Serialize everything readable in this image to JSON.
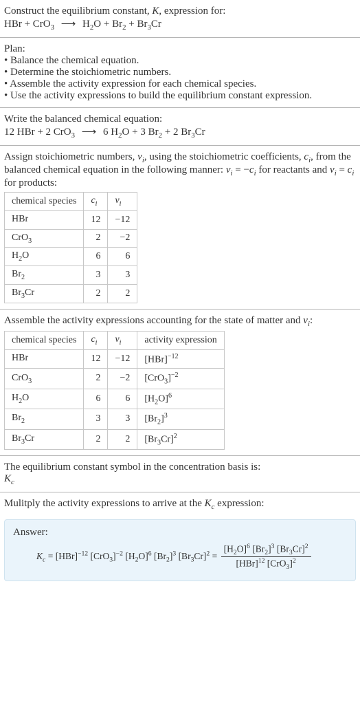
{
  "intro": {
    "line1_a": "Construct the equilibrium constant, ",
    "line1_K": "K",
    "line1_b": ", expression for:",
    "eq_lhs_1": "HBr + CrO",
    "eq_lhs_1_sub": "3",
    "arrow": "⟶",
    "eq_rhs_a": "H",
    "eq_rhs_a_sub": "2",
    "eq_rhs_b": "O + Br",
    "eq_rhs_b_sub": "2",
    "eq_rhs_c": " + Br",
    "eq_rhs_c_sub": "3",
    "eq_rhs_d": "Cr"
  },
  "plan": {
    "title": "Plan:",
    "b1": "• Balance the chemical equation.",
    "b2": "• Determine the stoichiometric numbers.",
    "b3": "• Assemble the activity expression for each chemical species.",
    "b4": "• Use the activity expressions to build the equilibrium constant expression."
  },
  "balance": {
    "title": "Write the balanced chemical equation:",
    "lhs_a": "12 HBr + 2 CrO",
    "lhs_a_sub": "3",
    "arrow": "⟶",
    "rhs_a": "6 H",
    "rhs_a_sub": "2",
    "rhs_b": "O + 3 Br",
    "rhs_b_sub": "2",
    "rhs_c": " + 2 Br",
    "rhs_c_sub": "3",
    "rhs_d": "Cr"
  },
  "assign": {
    "text_a": "Assign stoichiometric numbers, ",
    "nu_i": "ν",
    "nu_i_sub": "i",
    "text_b": ", using the stoichiometric coefficients, ",
    "c_i": "c",
    "c_i_sub": "i",
    "text_c": ", from the balanced chemical equation in the following manner: ",
    "rel_a": "ν",
    "rel_a_sub": "i",
    "rel_b": " = −",
    "rel_c": "c",
    "rel_c_sub": "i",
    "text_d": " for reactants and ",
    "rel_d": "ν",
    "rel_d_sub": "i",
    "rel_e": " = ",
    "rel_f": "c",
    "rel_f_sub": "i",
    "text_e": " for products:"
  },
  "table1": {
    "h1": "chemical species",
    "h2_a": "c",
    "h2_sub": "i",
    "h3_a": "ν",
    "h3_sub": "i",
    "rows": [
      {
        "sp_a": "HBr",
        "sp_sub": "",
        "sp_b": "",
        "c": "12",
        "n": "−12"
      },
      {
        "sp_a": "CrO",
        "sp_sub": "3",
        "sp_b": "",
        "c": "2",
        "n": "−2"
      },
      {
        "sp_a": "H",
        "sp_sub": "2",
        "sp_b": "O",
        "c": "6",
        "n": "6"
      },
      {
        "sp_a": "Br",
        "sp_sub": "2",
        "sp_b": "",
        "c": "3",
        "n": "3"
      },
      {
        "sp_a": "Br",
        "sp_sub": "3",
        "sp_b": "Cr",
        "c": "2",
        "n": "2"
      }
    ]
  },
  "assemble": {
    "text_a": "Assemble the activity expressions accounting for the state of matter and ",
    "nu": "ν",
    "nu_sub": "i",
    "text_b": ":"
  },
  "table2": {
    "h1": "chemical species",
    "h2_a": "c",
    "h2_sub": "i",
    "h3_a": "ν",
    "h3_sub": "i",
    "h4": "activity expression",
    "rows": [
      {
        "sp_a": "HBr",
        "sp_sub": "",
        "sp_b": "",
        "c": "12",
        "n": "−12",
        "ae_a": "[HBr]",
        "ae_sup": "−12"
      },
      {
        "sp_a": "CrO",
        "sp_sub": "3",
        "sp_b": "",
        "c": "2",
        "n": "−2",
        "ae_a": "[CrO",
        "ae_asub": "3",
        "ae_b": "]",
        "ae_sup": "−2"
      },
      {
        "sp_a": "H",
        "sp_sub": "2",
        "sp_b": "O",
        "c": "6",
        "n": "6",
        "ae_a": "[H",
        "ae_asub": "2",
        "ae_b": "O]",
        "ae_sup": "6"
      },
      {
        "sp_a": "Br",
        "sp_sub": "2",
        "sp_b": "",
        "c": "3",
        "n": "3",
        "ae_a": "[Br",
        "ae_asub": "2",
        "ae_b": "]",
        "ae_sup": "3"
      },
      {
        "sp_a": "Br",
        "sp_sub": "3",
        "sp_b": "Cr",
        "c": "2",
        "n": "2",
        "ae_a": "[Br",
        "ae_asub": "3",
        "ae_b": "Cr]",
        "ae_sup": "2"
      }
    ]
  },
  "symbol": {
    "line": "The equilibrium constant symbol in the concentration basis is:",
    "kc_a": "K",
    "kc_sub": "c"
  },
  "multiply": {
    "text_a": "Mulitply the activity expressions to arrive at the ",
    "kc_a": "K",
    "kc_sub": "c",
    "text_b": " expression:"
  },
  "answer": {
    "label": "Answer:",
    "kc_a": "K",
    "kc_sub": "c",
    "eq": " = ",
    "t1": "[HBr]",
    "t1_sup": "−12",
    "t2_a": "[CrO",
    "t2_sub": "3",
    "t2_b": "]",
    "t2_sup": "−2",
    "t3_a": "[H",
    "t3_sub": "2",
    "t3_b": "O]",
    "t3_sup": "6",
    "t4_a": "[Br",
    "t4_sub": "2",
    "t4_b": "]",
    "t4_sup": "3",
    "t5_a": "[Br",
    "t5_sub": "3",
    "t5_b": "Cr]",
    "t5_sup": "2",
    "eq2": " = ",
    "num_a": "[H",
    "num_a_sub": "2",
    "num_a2": "O]",
    "num_a_sup": "6",
    "num_b": " [Br",
    "num_b_sub": "2",
    "num_b2": "]",
    "num_b_sup": "3",
    "num_c": " [Br",
    "num_c_sub": "3",
    "num_c2": "Cr]",
    "num_c_sup": "2",
    "den_a": "[HBr]",
    "den_a_sup": "12",
    "den_b": " [CrO",
    "den_b_sub": "3",
    "den_b2": "]",
    "den_b_sup": "2"
  }
}
